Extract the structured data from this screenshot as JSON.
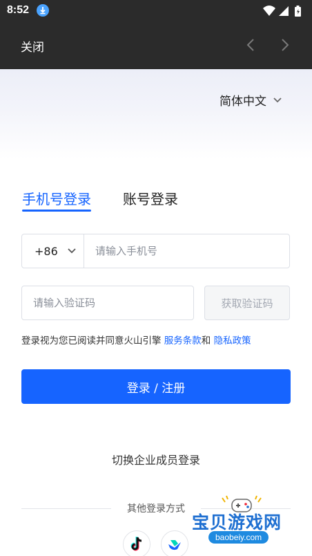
{
  "status_bar": {
    "time": "8:52"
  },
  "title_bar": {
    "close_label": "关闭"
  },
  "language": {
    "label": "简体中文"
  },
  "tabs": [
    {
      "label": "手机号登录",
      "active": true
    },
    {
      "label": "账号登录",
      "active": false
    }
  ],
  "phone": {
    "country_code": "+86",
    "placeholder": "请输入手机号"
  },
  "code": {
    "placeholder": "请输入验证码",
    "get_code_label": "获取验证码"
  },
  "agreement": {
    "prefix": "登录视为您已阅读并同意火山引擎 ",
    "terms": "服务条款",
    "and": "和 ",
    "privacy": "隐私政策"
  },
  "login_button": "登录 / 注册",
  "switch_enterprise": "切换企业成员登录",
  "other_login": {
    "title": "其他登录方式",
    "providers": [
      "tiktok-icon",
      "feishu-icon"
    ]
  },
  "watermark": {
    "title": "宝贝游戏网",
    "url": "baobeiy.com"
  },
  "colors": {
    "accent": "#1664ff",
    "topbar": "#2b2b2b"
  }
}
